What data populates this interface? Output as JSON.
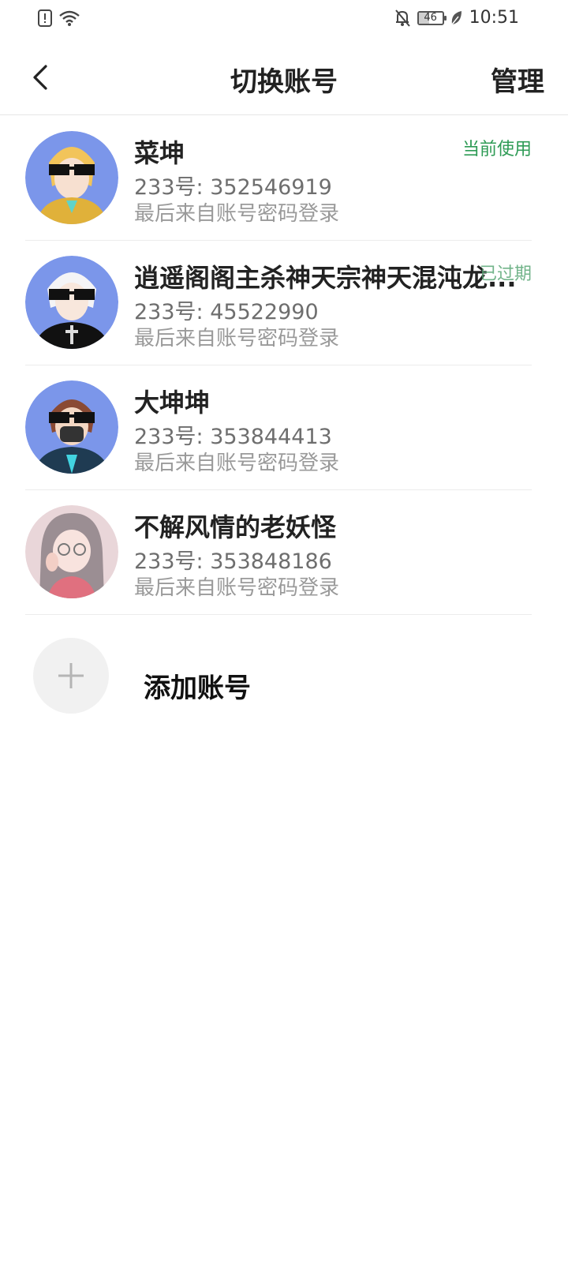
{
  "status_bar": {
    "time": "10:51",
    "battery_level": "46",
    "icons": [
      "alert-icon",
      "wifi-icon",
      "bell-off-icon",
      "battery-icon",
      "leaf-icon"
    ]
  },
  "header": {
    "title": "切换账号",
    "manage_label": "管理"
  },
  "accounts": [
    {
      "name": "菜坤",
      "id_text": "233号: 352546919",
      "login_text": "最后来自账号密码登录",
      "status": "当前使用"
    },
    {
      "name": "逍遥阁阁主杀神天宗神天混沌龙...",
      "id_text": "233号: 45522990",
      "login_text": "最后来自账号密码登录",
      "status": "已过期"
    },
    {
      "name": "大坤坤",
      "id_text": "233号: 353844413",
      "login_text": "最后来自账号密码登录",
      "status": ""
    },
    {
      "name": "不解风情的老妖怪",
      "id_text": "233号: 353848186",
      "login_text": "最后来自账号密码登录",
      "status": ""
    }
  ],
  "add_account": {
    "label": "添加账号"
  },
  "colors": {
    "status_green": "#2e9b55",
    "divider": "#ececec",
    "avatar_bg": "#7b96ea"
  }
}
